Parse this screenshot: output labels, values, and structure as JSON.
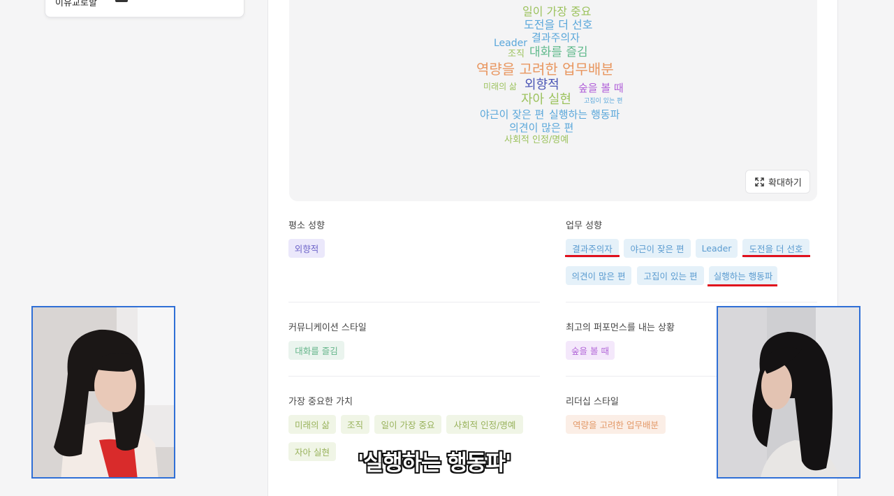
{
  "wordcloud": {
    "words": [
      {
        "text": "일이 가장 중요",
        "color": "#9cc25d"
      },
      {
        "text": "도전을 더 선호",
        "color": "#5aa7da"
      },
      {
        "text": "결과주의자",
        "color": "#5aa7da"
      },
      {
        "text": "Leader",
        "color": "#5aa7da"
      },
      {
        "text": "조직",
        "color": "#9cc25d"
      },
      {
        "text": "대화를 즐김",
        "color": "#5fb98b"
      },
      {
        "text": "역량을 고려한 업무배분",
        "color": "#e8965f"
      },
      {
        "text": "미래의 삶",
        "color": "#9cc25d"
      },
      {
        "text": "외향적",
        "color": "#4a55b5"
      },
      {
        "text": "숲을 볼 때",
        "color": "#b05fd8"
      },
      {
        "text": "자아 실현",
        "color": "#9cc25d"
      },
      {
        "text": "고집이 있는 편",
        "color": "#5aa7da"
      },
      {
        "text": "야근이 잦은 편",
        "color": "#5aa7da"
      },
      {
        "text": "실행하는 행동파",
        "color": "#5aa7da"
      },
      {
        "text": "의견이 많은 편",
        "color": "#5aa7da"
      },
      {
        "text": "사회적 인정/명예",
        "color": "#9cc25d"
      }
    ],
    "expand_label": "확대하기"
  },
  "top_card": {
    "partial_text": "이유교로할"
  },
  "sections": {
    "daily": {
      "title": "평소 성향",
      "tags": [
        "외향적"
      ]
    },
    "work": {
      "title": "업무 성향",
      "tags": [
        "결과주의자",
        "야근이 잦은 편",
        "Leader",
        "도전을 더 선호",
        "의견이 많은 편",
        "고집이 있는 편",
        "실행하는 행동파"
      ]
    },
    "communication": {
      "title": "커뮤니케이션 스타일",
      "tags": [
        "대화를 즐김"
      ]
    },
    "best_performance": {
      "title": "최고의 퍼포먼스를 내는 상황",
      "tags": [
        "숲을 볼 때"
      ]
    },
    "values": {
      "title": "가장 중요한 가치",
      "tags": [
        "미래의 삶",
        "조직",
        "일이 가장 중요",
        "사회적 인정/명예",
        "자아 실현"
      ]
    },
    "leadership": {
      "title": "리더십 스타일",
      "tags": [
        "역량을 고려한 업무배분"
      ]
    }
  },
  "subtitle": "'실행하는 행동파'",
  "colors": {
    "highlight_underline": "#e0101c",
    "video_border": "#2f6fd6"
  }
}
